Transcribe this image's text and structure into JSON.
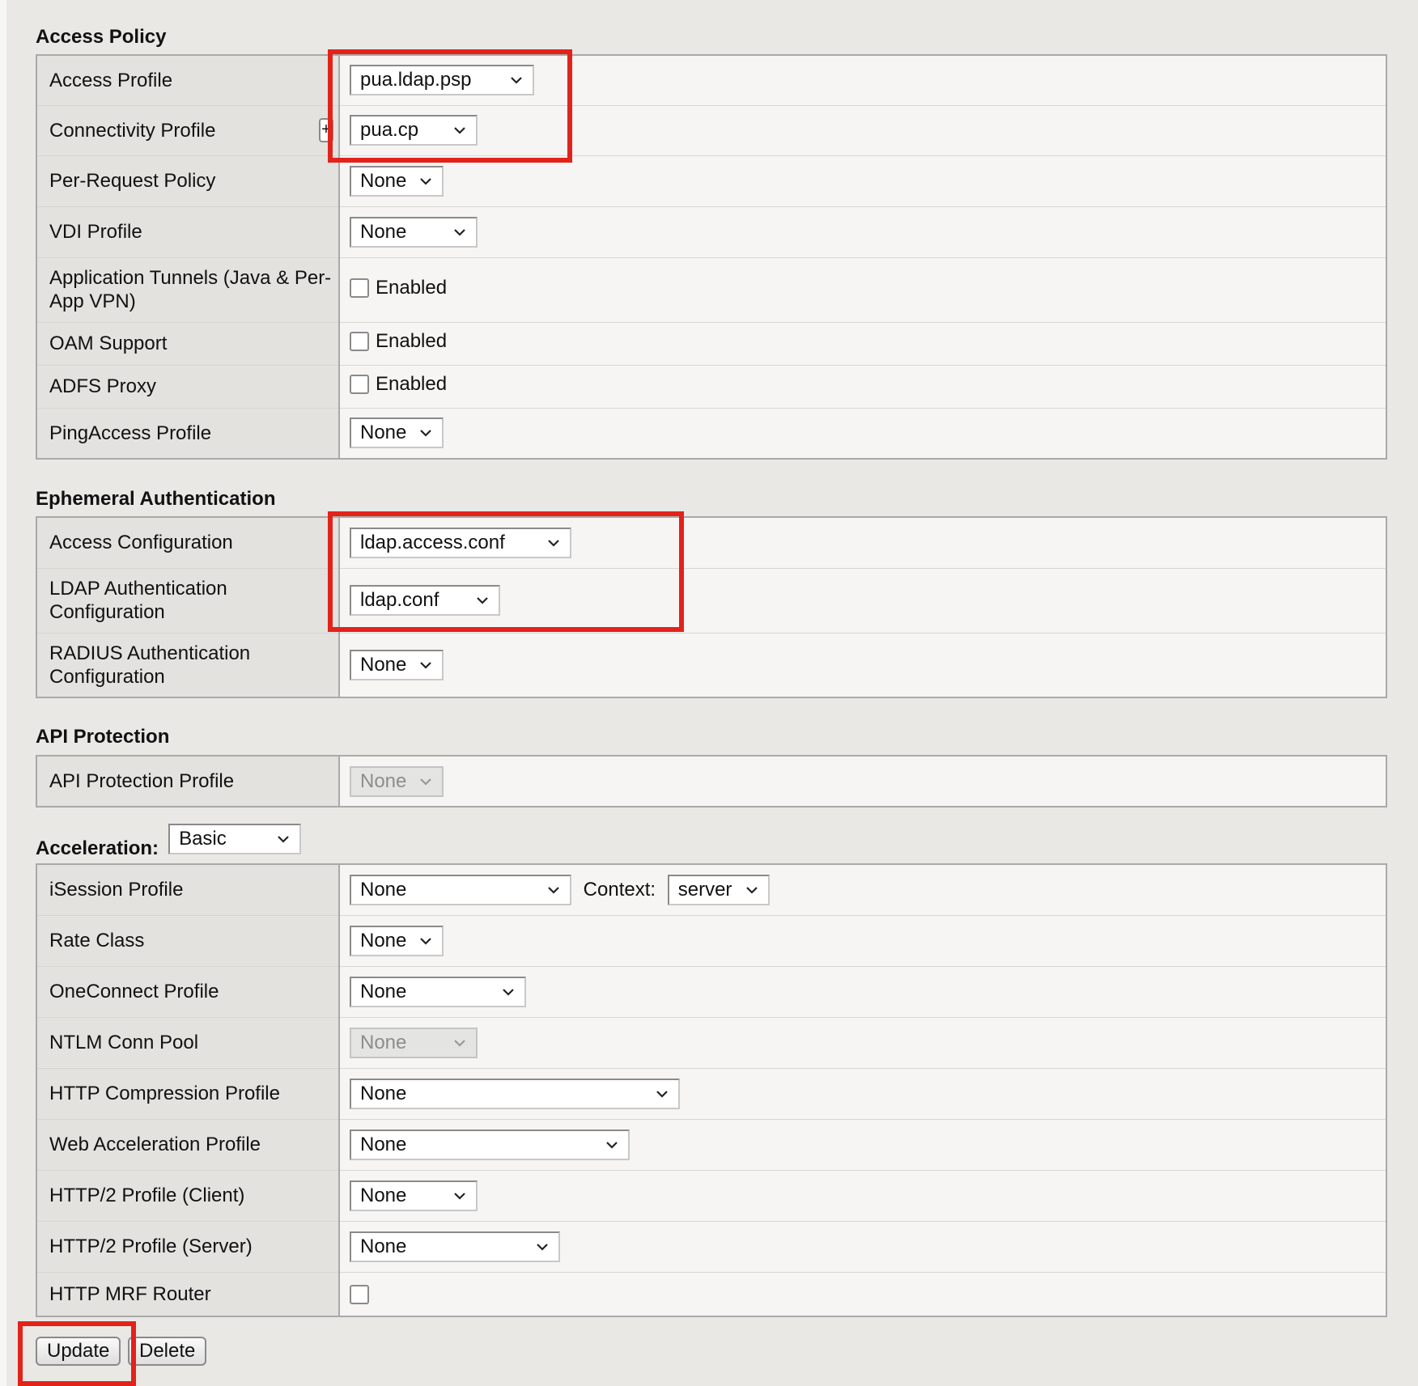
{
  "sections": {
    "access_policy": {
      "title": "Access Policy",
      "rows": {
        "access_profile": {
          "label": "Access Profile",
          "value": "pua.ldap.psp"
        },
        "connectivity_profile": {
          "label": "Connectivity Profile",
          "value": "pua.cp",
          "plus": "+"
        },
        "per_request_policy": {
          "label": "Per-Request Policy",
          "value": "None"
        },
        "vdi_profile": {
          "label": "VDI Profile",
          "value": "None"
        },
        "application_tunnels": {
          "label": "Application Tunnels (Java & Per-App VPN)",
          "check_label": "Enabled",
          "checked": false
        },
        "oam_support": {
          "label": "OAM Support",
          "check_label": "Enabled",
          "checked": false
        },
        "adfs_proxy": {
          "label": "ADFS Proxy",
          "check_label": "Enabled",
          "checked": false
        },
        "pingaccess_profile": {
          "label": "PingAccess Profile",
          "value": "None"
        }
      }
    },
    "ephemeral_auth": {
      "title": "Ephemeral Authentication",
      "rows": {
        "access_configuration": {
          "label": "Access Configuration",
          "value": "ldap.access.conf"
        },
        "ldap_auth_config": {
          "label": "LDAP Authentication Configuration",
          "value": "ldap.conf"
        },
        "radius_auth_config": {
          "label": "RADIUS Authentication Configuration",
          "value": "None"
        }
      }
    },
    "api_protection": {
      "title": "API Protection",
      "rows": {
        "api_protection_profile": {
          "label": "API Protection Profile",
          "value": "None",
          "disabled": true
        }
      }
    },
    "acceleration": {
      "title": "Acceleration:",
      "mode": "Basic",
      "rows": {
        "isession_profile": {
          "label": "iSession Profile",
          "value": "None",
          "context_label": "Context:",
          "context_value": "server"
        },
        "rate_class": {
          "label": "Rate Class",
          "value": "None"
        },
        "oneconnect_profile": {
          "label": "OneConnect Profile",
          "value": "None"
        },
        "ntlm_conn_pool": {
          "label": "NTLM Conn Pool",
          "value": "None",
          "disabled": true
        },
        "http_compression_profile": {
          "label": "HTTP Compression Profile",
          "value": "None"
        },
        "web_acceleration_profile": {
          "label": "Web Acceleration Profile",
          "value": "None"
        },
        "http2_client": {
          "label": "HTTP/2 Profile (Client)",
          "value": "None"
        },
        "http2_server": {
          "label": "HTTP/2 Profile (Server)",
          "value": "None"
        },
        "http_mrf_router": {
          "label": "HTTP MRF Router",
          "checked": false
        }
      }
    }
  },
  "buttons": {
    "update": "Update",
    "delete": "Delete"
  },
  "colors": {
    "highlight": "#e2231a",
    "label_bg": "#e3e2df",
    "value_bg": "#f6f5f3"
  }
}
